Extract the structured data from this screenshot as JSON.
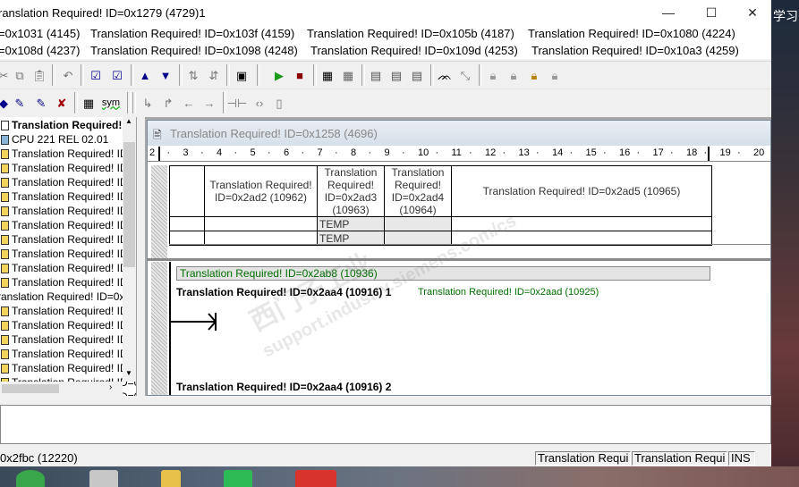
{
  "window": {
    "title": "ranslation Required! ID=0x1279 (4729)1",
    "minimize": "—",
    "maximize": "☐",
    "close": "✕"
  },
  "menu": {
    "row1": [
      "=0x1031 (4145)",
      "Translation Required! ID=0x103f (4159)",
      "Translation Required! ID=0x105b (4187)",
      "Translation Required! ID=0x1080 (4224)"
    ],
    "row2": [
      "=0x108d (4237)",
      "Translation Required! ID=0x1098 (4248)",
      "Translation Required! ID=0x109d (4253)",
      "Translation Required! ID=0x10a3 (4259)"
    ]
  },
  "ime": "学习",
  "toolbar2": {
    "sym_label": "sym"
  },
  "tree": {
    "items": [
      {
        "label": "Translation Required!",
        "bold": true,
        "icon": "project-icon"
      },
      {
        "label": "CPU 221 REL 02.01",
        "icon": "cpu-icon"
      },
      {
        "label": "Translation Required! ID=0",
        "icon": "program-icon"
      },
      {
        "label": "Translation Required! ID=0",
        "icon": "symbol-icon"
      },
      {
        "label": "Translation Required! ID=0",
        "icon": "status-icon"
      },
      {
        "label": "Translation Required! ID=0",
        "icon": "data-icon"
      },
      {
        "label": "Translation Required! ID=0",
        "icon": "block-icon"
      },
      {
        "label": "Translation Required! ID=0",
        "icon": "xref-icon"
      },
      {
        "label": "Translation Required! ID=0",
        "icon": "comm-icon"
      },
      {
        "label": "Translation Required! ID=0",
        "icon": "wizard-icon"
      },
      {
        "label": "Translation Required! ID=0",
        "icon": "tools-icon"
      },
      {
        "label": "Translation Required! ID=0",
        "icon": "folder-icon"
      },
      {
        "label": "ranslation Required! ID=0x12",
        "icon": "none"
      },
      {
        "label": "Translation Required! ID=0",
        "icon": "instr-icon"
      },
      {
        "label": "Translation Required! ID=0",
        "icon": "instr-icon"
      },
      {
        "label": "Translation Required! ID=0",
        "icon": "instr-icon"
      },
      {
        "label": "Translation Required! ID=0",
        "icon": "instr-icon"
      },
      {
        "label": "Translation Required! ID=0",
        "icon": "instr-icon"
      },
      {
        "label": "Translation Required! ID=0",
        "icon": "instr-icon"
      },
      {
        "label": "Translation Required! ID=0",
        "icon": "instr-icon"
      }
    ],
    "partial_last": "Translation Required! ID=0"
  },
  "editor": {
    "title": "Translation Required! ID=0x1258 (4696)",
    "ruler": [
      "2",
      "3",
      "4",
      "5",
      "6",
      "7",
      "8",
      "9",
      "10",
      "11",
      "12",
      "13",
      "14",
      "15",
      "16",
      "17",
      "18",
      "19",
      "20"
    ],
    "var_table": {
      "headers": [
        "Translation Required! ID=0x2ad2 (10962)",
        "Translation Required! ID=0x2ad3 (10963)",
        "Translation Required! ID=0x2ad4 (10964)",
        "Translation Required! ID=0x2ad5 (10965)"
      ],
      "rows": [
        [
          "",
          "TEMP",
          "",
          ""
        ],
        [
          "",
          "TEMP",
          "",
          ""
        ]
      ]
    },
    "program_comment": "Translation Required! ID=0x2ab8 (10936)",
    "network1": {
      "title": "Translation Required! ID=0x2aa4 (10916) 1",
      "comment": "Translation Required! ID=0x2aad (10925)"
    },
    "network2": {
      "title": "Translation Required! ID=0x2aa4 (10916) 2"
    }
  },
  "status": {
    "left": "0x2fbc (12220)",
    "cell1": "Translation Requi",
    "cell2": "Translation Requi",
    "cell3": "INS"
  },
  "watermark": {
    "line1": "西门子工业",
    "line2": "support.industry.siemens.com/cs"
  },
  "colors": {
    "green_text": "#007000",
    "title_gradient": "#d6dfe8"
  }
}
